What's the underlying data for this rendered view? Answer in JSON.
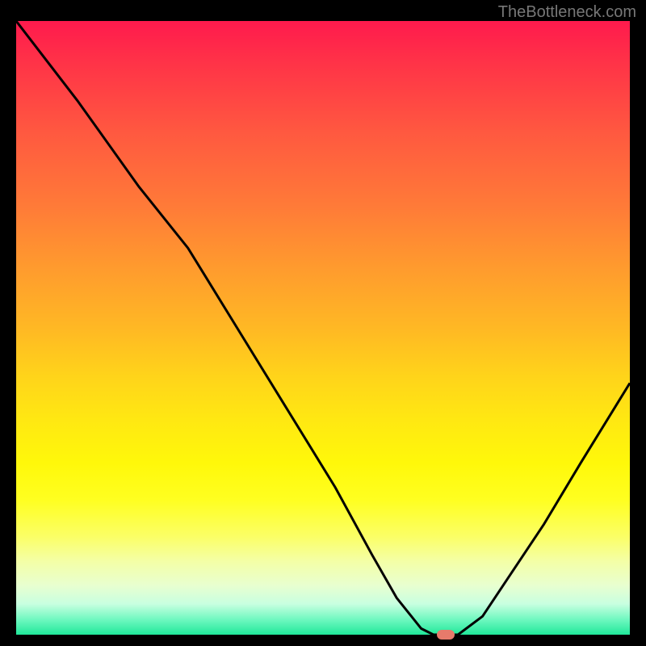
{
  "watermark": "TheBottleneck.com",
  "chart_data": {
    "type": "line",
    "title": "",
    "xlabel": "",
    "ylabel": "",
    "xlim": [
      0,
      100
    ],
    "ylim": [
      0,
      100
    ],
    "series": [
      {
        "name": "bottleneck-curve",
        "x": [
          0,
          10,
          20,
          28,
          36,
          44,
          52,
          58,
          62,
          66,
          68,
          72,
          76,
          80,
          86,
          92,
          100
        ],
        "values": [
          100,
          87,
          73,
          63,
          50,
          37,
          24,
          13,
          6,
          1,
          0,
          0,
          3,
          9,
          18,
          28,
          41
        ]
      }
    ],
    "marker": {
      "x": 70,
      "y": 0
    },
    "gradient_stops": [
      {
        "pos": 0,
        "color": "#ff1a4d"
      },
      {
        "pos": 50,
        "color": "#ffd41a"
      },
      {
        "pos": 100,
        "color": "#20e89a"
      }
    ]
  }
}
